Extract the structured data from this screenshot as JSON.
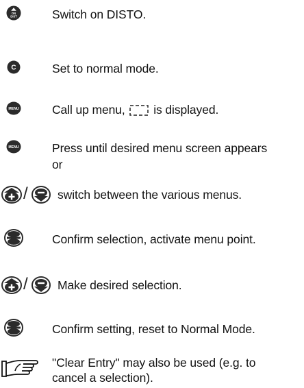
{
  "steps": [
    {
      "id": "on-disto",
      "icon": "on-disto-button-icon",
      "text": "Switch on DISTO."
    },
    {
      "id": "clear",
      "icon": "clear-button-icon",
      "text": "Set  to normal mode."
    },
    {
      "id": "menu-call",
      "icon": "menu-button-icon",
      "text_before": "Call up menu,",
      "text_after": "is displayed.",
      "inline_icon": "menu-display-symbol-icon"
    },
    {
      "id": "menu-press",
      "icon": "menu-button-icon",
      "text": "Press until desired menu screen appears",
      "text_line2": "or"
    },
    {
      "id": "plus-minus-switch",
      "icon": "plus-minus-buttons-icon",
      "separator": "/",
      "text": "switch between the various menus."
    },
    {
      "id": "equal-confirm-1",
      "icon": "equal-button-icon",
      "text": "Confirm selection, activate menu point."
    },
    {
      "id": "plus-minus-select",
      "icon": "plus-minus-buttons-icon",
      "separator": "/",
      "text": "Make desired selection."
    },
    {
      "id": "equal-confirm-2",
      "icon": "equal-button-icon",
      "text": "Confirm setting, reset to Normal Mode."
    },
    {
      "id": "note",
      "icon": "pointing-hand-icon",
      "text": "\"Clear Entry\" may also be used (e.g. to",
      "text_line2": "cancel a selection)."
    }
  ],
  "icon_labels": {
    "on_top": "ON",
    "on_bottom": "DIST",
    "clear": "C",
    "menu": "MENU"
  },
  "colors": {
    "icon_dark": "#2b2b2b",
    "icon_text": "#ffffff",
    "text": "#111111"
  }
}
